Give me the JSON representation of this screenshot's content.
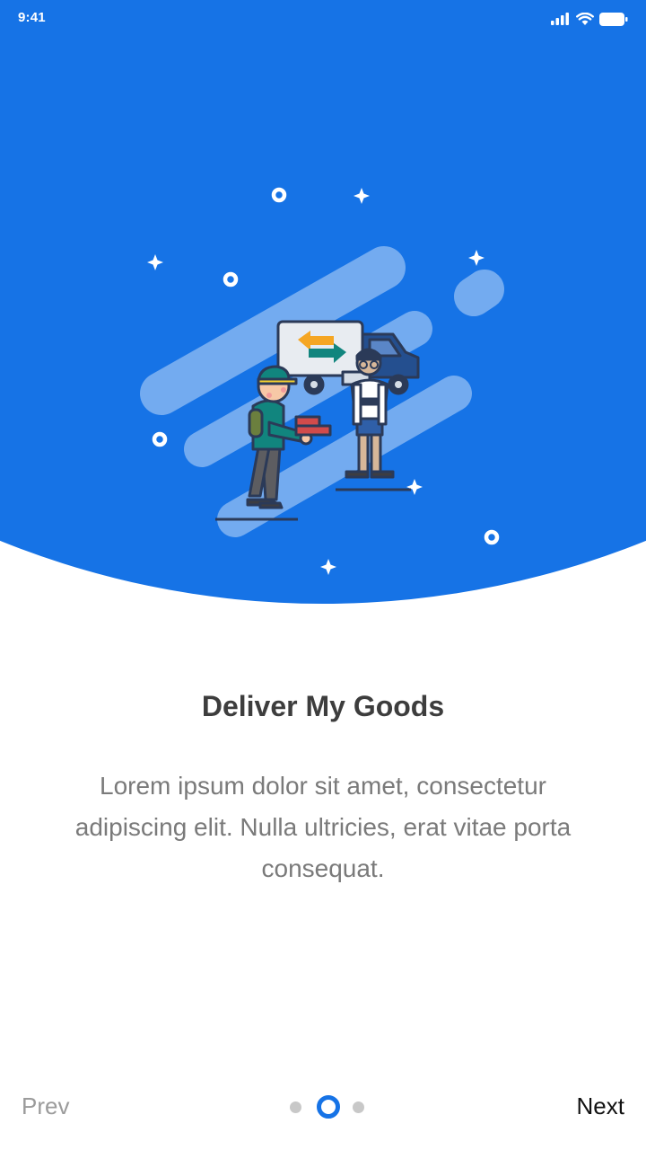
{
  "colors": {
    "accent": "#1673e6",
    "title": "#3d3d3d",
    "body_text": "#7a7a7a",
    "inactive_dot": "#c8c8c8"
  },
  "status_bar": {
    "time": "9:41",
    "icons": [
      "signal-icon",
      "wifi-icon",
      "battery-icon"
    ]
  },
  "onboarding": {
    "illustration": "delivery-courier-with-truck",
    "title": "Deliver My Goods",
    "description": "Lorem ipsum dolor sit amet, consectetur adipiscing elit. Nulla ultricies, erat vitae porta consequat."
  },
  "navigation": {
    "prev_label": "Prev",
    "next_label": "Next",
    "pages": 3,
    "current_page": 2
  }
}
